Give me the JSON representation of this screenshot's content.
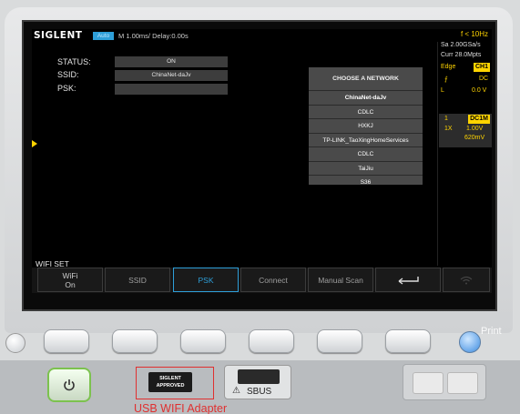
{
  "topbar": {
    "brand": "SIGLENT",
    "mode": "Auto",
    "timebase": "M 1.00ms/ Delay:0.00s",
    "trigger_freq": "f < 10Hz"
  },
  "wifi": {
    "status_label": "STATUS:",
    "status_value": "ON",
    "ssid_label": "SSID:",
    "ssid_value": "ChinaNet-daJv",
    "psk_label": "PSK:",
    "psk_value": ""
  },
  "networks": {
    "title": "CHOOSE A NETWORK",
    "items": [
      "ChinaNet-daJv",
      "CDLC",
      "HXKJ",
      "TP-LINK_TaoXingHomeServices",
      "CDLC",
      "TaiJiu",
      "S36"
    ],
    "selected_index": 0
  },
  "side_panel": {
    "sample_rate": "Sa 2.00GSa/s",
    "memory": "Curr 28.0Mpts",
    "trigger_type": "Edge",
    "trigger_channel": "CH1",
    "slope_symbol": "⨍",
    "coupling": "DC",
    "level_symbol": "L",
    "level": "0.0 V",
    "ch_number": "1",
    "ch_coupling": "DC1M",
    "probe": "1X",
    "volts_div": "1.00V",
    "offset": "620mV"
  },
  "menu": {
    "title": "WIFI SET",
    "buttons": [
      "WiFi\nOn",
      "SSID",
      "PSK",
      "Connect",
      "Manual Scan",
      "",
      ""
    ],
    "active_index": 2
  },
  "hardware": {
    "print_label": "Print",
    "usb_plug_text": "SIGLENT\nAPPROVED",
    "usb_label": "USB WIFI Adapter",
    "sbus_label": "SBUS"
  },
  "colors": {
    "accent_blue": "#2e9fd9",
    "trigger_yellow": "#ffd400",
    "annotation_red": "#e03030"
  }
}
